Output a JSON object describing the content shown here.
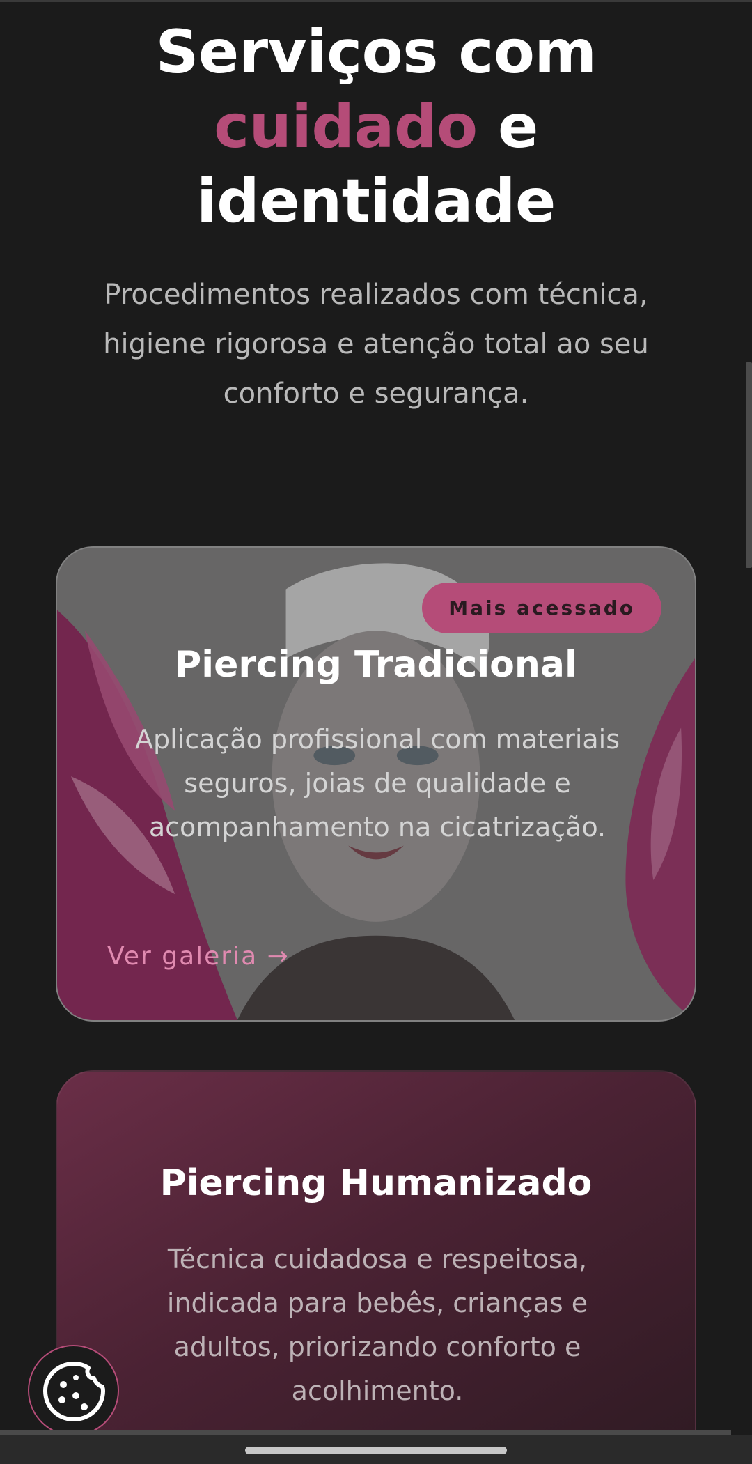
{
  "heading": {
    "line1": "Serviços com",
    "accent_word": "cuidado",
    "line2_rest": " e",
    "line3": "identidade"
  },
  "intro": "Procedimentos realizados com técnica, higiene rigorosa e atenção total ao seu conforto e segurança.",
  "services": [
    {
      "badge": "Mais acessado",
      "title": "Piercing Tradicional",
      "description": "Aplicação profissional com materiais seguros, joias de qualidade e acompanhamento na cicatrização.",
      "link_label": "Ver galeria",
      "link_arrow": "→"
    },
    {
      "title": "Piercing Humanizado",
      "description": "Técnica cuidadosa e respeitosa, indicada para bebês, crianças e adultos, priorizando conforto e acolhimento."
    }
  ],
  "icons": {
    "cookie": "cookie-icon"
  },
  "colors": {
    "background": "#1b1b1b",
    "accent": "#b54c78",
    "link": "#e08ab0",
    "text_muted": "#b9b9b9"
  }
}
